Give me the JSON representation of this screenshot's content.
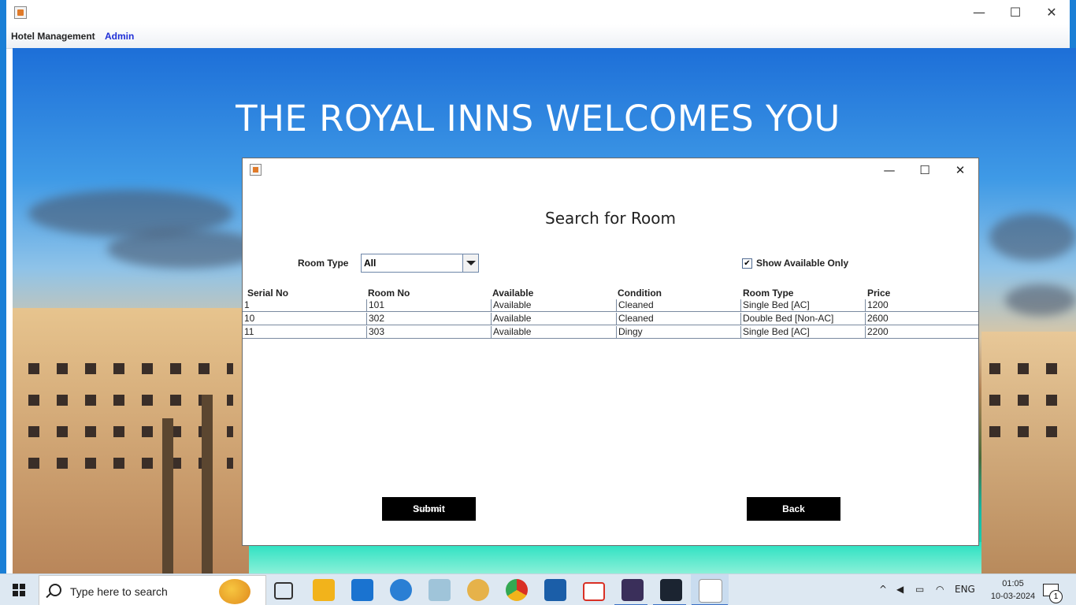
{
  "app": {
    "menu": {
      "hotel_management": "Hotel Management",
      "admin": "Admin"
    },
    "window_controls": {
      "minimize": "—",
      "maximize": "☐",
      "close": "✕"
    }
  },
  "welcome_banner": "THE ROYAL INNS WELCOMES YOU",
  "dialog": {
    "title": "Search for Room",
    "window_controls": {
      "minimize": "—",
      "maximize": "☐",
      "close": "✕"
    },
    "room_type_label": "Room Type",
    "room_type_selected": "All",
    "show_available_label": "Show Available Only",
    "show_available_checked": true,
    "check_glyph": "✔",
    "table": {
      "headers": [
        "Serial No",
        "Room No",
        "Available",
        "Condition",
        "Room Type",
        "Price"
      ],
      "rows": [
        [
          "1",
          "101",
          "Available",
          "Cleaned",
          "Single Bed [AC]",
          "1200"
        ],
        [
          "10",
          "302",
          "Available",
          "Cleaned",
          "Double Bed [Non-AC]",
          "2600"
        ],
        [
          "11",
          "303",
          "Available",
          "Dingy",
          "Single Bed [AC]",
          "2200"
        ]
      ]
    },
    "submit_label": "Submit",
    "back_label": "Back"
  },
  "taskbar": {
    "search_placeholder": "Type here to search",
    "tray": {
      "language": "ENG",
      "time": "01:05",
      "date": "10-03-2024",
      "notification_count": "1"
    },
    "colors": {
      "edge": "#2a7fd4",
      "chrome": "#34a853",
      "mail": "#1a73d0",
      "gmail": "#d93025",
      "files": "#f2b31b"
    }
  }
}
